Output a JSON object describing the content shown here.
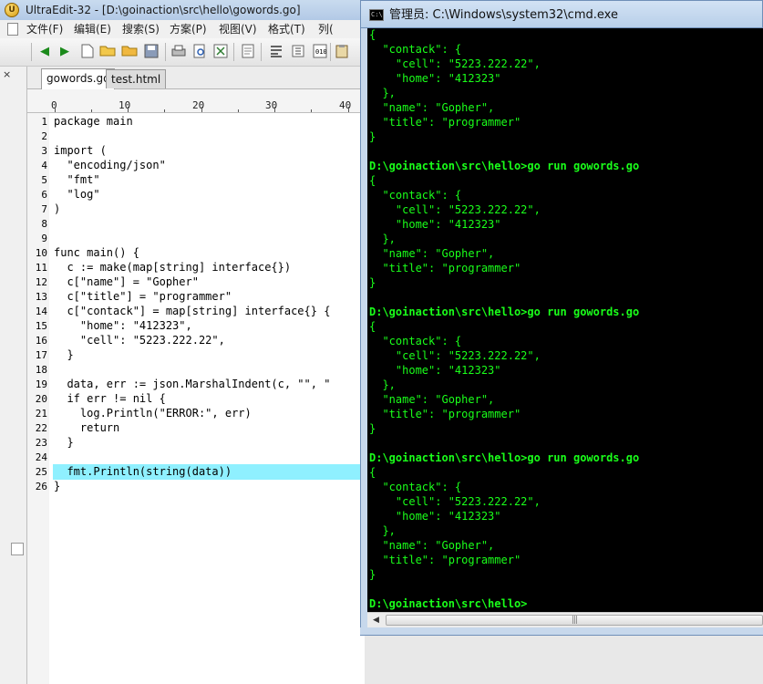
{
  "ultraedit": {
    "title": "UltraEdit-32 - [D:\\goinaction\\src\\hello\\gowords.go]",
    "menu": [
      "文件(F)",
      "编辑(E)",
      "搜索(S)",
      "方案(P)",
      "视图(V)",
      "格式(T)",
      "列("
    ],
    "tabs": [
      "gowords.go",
      "test.html"
    ],
    "active_tab": "gowords.go",
    "ruler": [
      "0",
      "10",
      "20",
      "30",
      "40"
    ],
    "close_glyph": "×",
    "code_lines": [
      "package main",
      "",
      "import (",
      "  \"encoding/json\"",
      "  \"fmt\"",
      "  \"log\"",
      ")",
      "",
      "",
      "func main() {",
      "  c := make(map[string] interface{})",
      "  c[\"name\"] = \"Gopher\"",
      "  c[\"title\"] = \"programmer\"",
      "  c[\"contack\"] = map[string] interface{} {",
      "    \"home\": \"412323\",",
      "    \"cell\": \"5223.222.22\",",
      "  }",
      "",
      "  data, err := json.MarshalIndent(c, \"\", \"",
      "  if err != nil {",
      "    log.Println(\"ERROR:\", err)",
      "    return",
      "  }",
      "",
      "  fmt.Println(string(data))",
      "}"
    ],
    "line_numbers": [
      "1",
      "2",
      "3",
      "4",
      "5",
      "6",
      "7",
      "8",
      "9",
      "10",
      "11",
      "12",
      "13",
      "14",
      "15",
      "16",
      "17",
      "18",
      "19",
      "20",
      "21",
      "22",
      "23",
      "24",
      "25",
      "26"
    ],
    "current_line": "25",
    "highlight_color": "#8ff0ff"
  },
  "cmd": {
    "title": "管理员: C:\\Windows\\system32\\cmd.exe",
    "icon_text": "C:\\",
    "text_color": "#1aff1a",
    "scroll_grip": "|||",
    "lines": [
      "{",
      "  \"contack\": {",
      "    \"cell\": \"5223.222.22\",",
      "    \"home\": \"412323\"",
      "  },",
      "  \"name\": \"Gopher\",",
      "  \"title\": \"programmer\"",
      "}",
      "",
      "D:\\goinaction\\src\\hello>go run gowords.go",
      "{",
      "  \"contack\": {",
      "    \"cell\": \"5223.222.22\",",
      "    \"home\": \"412323\"",
      "  },",
      "  \"name\": \"Gopher\",",
      "  \"title\": \"programmer\"",
      "}",
      "",
      "D:\\goinaction\\src\\hello>go run gowords.go",
      "{",
      "  \"contack\": {",
      "    \"cell\": \"5223.222.22\",",
      "    \"home\": \"412323\"",
      "  },",
      "  \"name\": \"Gopher\",",
      "  \"title\": \"programmer\"",
      "}",
      "",
      "D:\\goinaction\\src\\hello>go run gowords.go",
      "{",
      "  \"contack\": {",
      "    \"cell\": \"5223.222.22\",",
      "    \"home\": \"412323\"",
      "  },",
      "  \"name\": \"Gopher\",",
      "  \"title\": \"programmer\"",
      "}",
      "",
      "D:\\goinaction\\src\\hello>"
    ]
  }
}
